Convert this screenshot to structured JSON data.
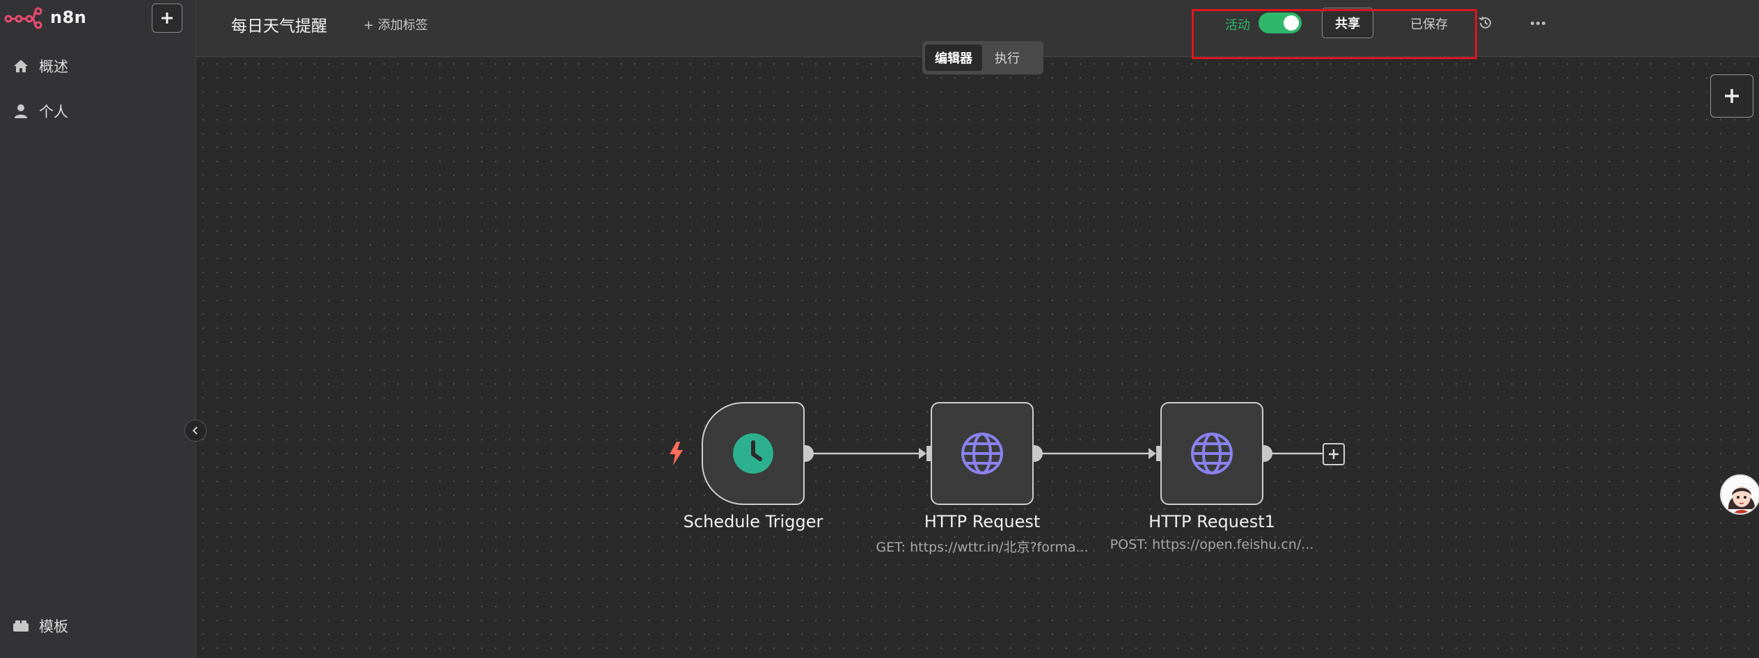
{
  "app": {
    "brand_name": "n8n",
    "brand_color": "#ea4b71"
  },
  "sidebar": {
    "items": [
      {
        "label": "概述",
        "icon": "home-icon"
      },
      {
        "label": "个人",
        "icon": "user-icon"
      },
      {
        "label": "模板",
        "icon": "templates-icon"
      }
    ]
  },
  "header": {
    "workflow_title": "每日天气提醒",
    "add_tag": "+ 添加标签",
    "active_label": "活动",
    "active": true,
    "share_label": "共享",
    "saved_label": "已保存"
  },
  "tabs": [
    {
      "label": "编辑器",
      "active": true
    },
    {
      "label": "执行",
      "active": false
    }
  ],
  "nodes": [
    {
      "title": "Schedule Trigger",
      "subtitle": "",
      "icon": "clock-icon"
    },
    {
      "title": "HTTP Request",
      "subtitle": "GET: https://wttr.in/北京?forma...",
      "icon": "globe-icon"
    },
    {
      "title": "HTTP Request1",
      "subtitle": "POST: https://open.feishu.cn/...",
      "icon": "globe-icon"
    }
  ],
  "colors": {
    "accent_green": "#2fb86b",
    "trigger_bolt": "#ff6d5a",
    "globe_purple": "#8b82f0",
    "highlight_red": "#e0141e"
  }
}
